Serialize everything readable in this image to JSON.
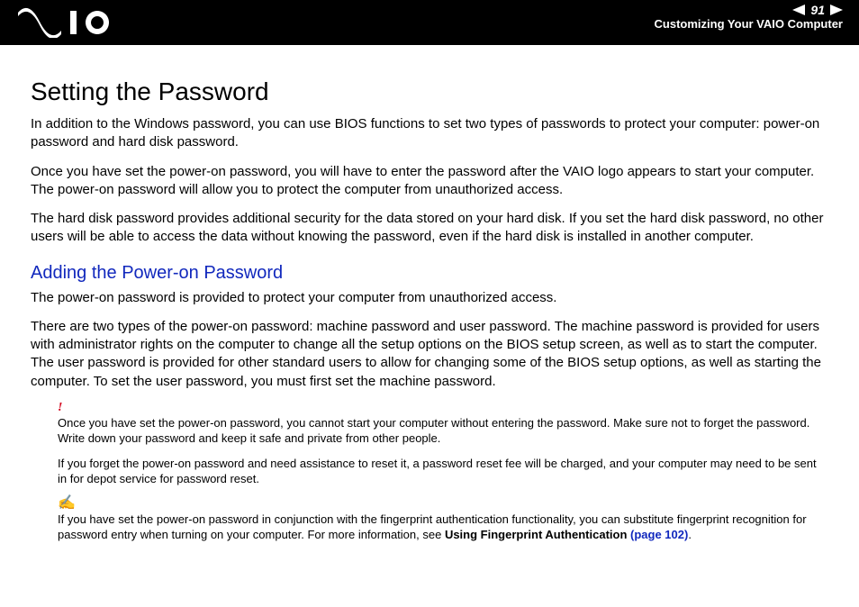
{
  "header": {
    "page_number": "91",
    "breadcrumb": "Customizing Your VAIO Computer"
  },
  "main": {
    "title": "Setting the Password",
    "p1": "In addition to the Windows password, you can use BIOS functions to set two types of passwords to protect your computer: power-on password and hard disk password.",
    "p2": "Once you have set the power-on password, you will have to enter the password after the VAIO logo appears to start your computer. The power-on password will allow you to protect the computer from unauthorized access.",
    "p3": "The hard disk password provides additional security for the data stored on your hard disk. If you set the hard disk password, no other users will be able to access the data without knowing the password, even if the hard disk is installed in another computer.",
    "subheading": "Adding the Power-on Password",
    "p4": "The power-on password is provided to protect your computer from unauthorized access.",
    "p5": "There are two types of the power-on password: machine password and user password. The machine password is provided for users with administrator rights on the computer to change all the setup options on the BIOS setup screen, as well as to start the computer. The user password is provided for other standard users to allow for changing some of the BIOS setup options, as well as starting the computer. To set the user password, you must first set the machine password."
  },
  "warning": {
    "icon": "!",
    "p1": "Once you have set the power-on password, you cannot start your computer without entering the password. Make sure not to forget the password. Write down your password and keep it safe and private from other people.",
    "p2": "If you forget the power-on password and need assistance to reset it, a password reset fee will be charged, and your computer may need to be sent in for depot service for password reset."
  },
  "tip": {
    "icon": "✍",
    "p1_pre": "If you have set the power-on password in conjunction with the fingerprint authentication functionality, you can substitute fingerprint recognition for password entry when turning on your computer. For more information, see ",
    "p1_strong": "Using Fingerprint Authentication ",
    "p1_link": "(page 102)",
    "p1_post": "."
  }
}
